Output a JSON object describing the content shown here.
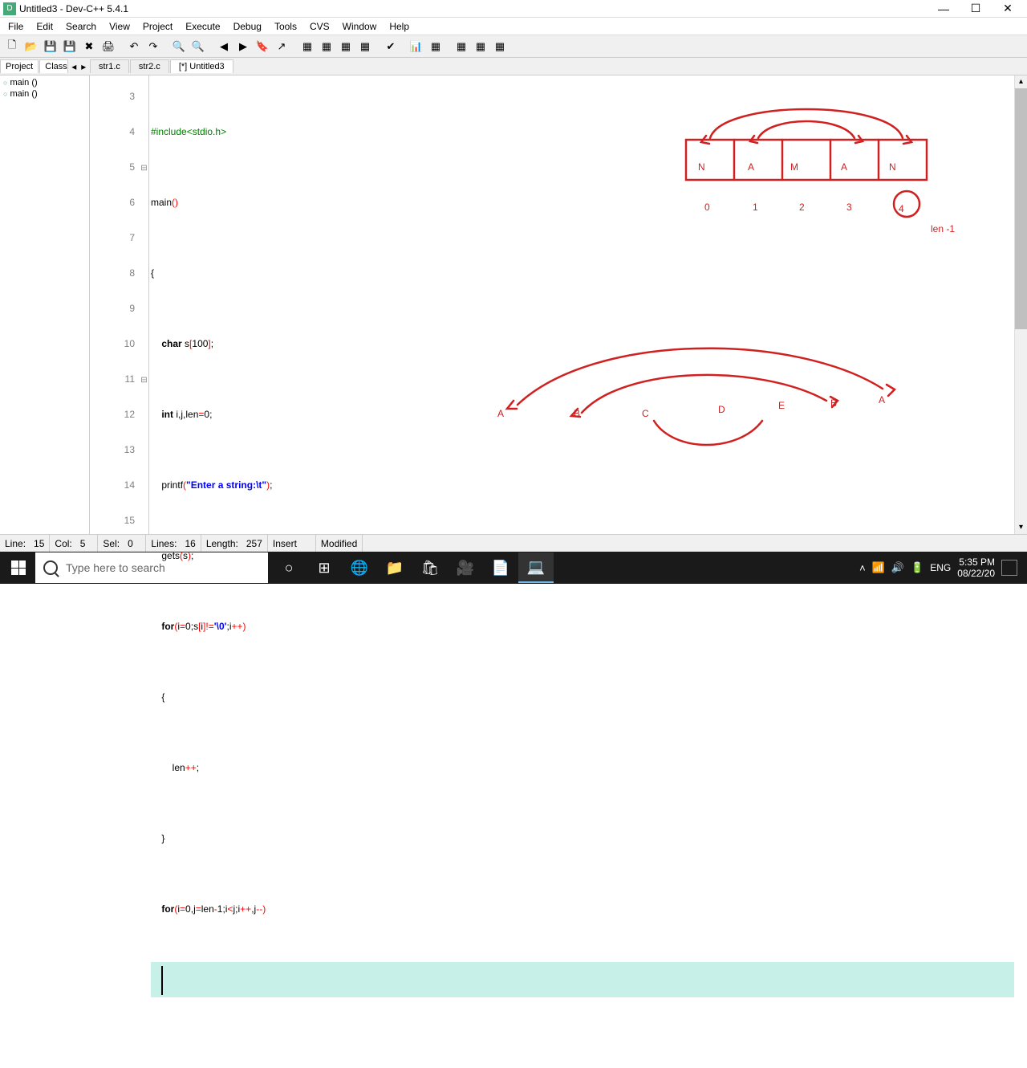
{
  "window": {
    "title": "Untitled3 - Dev-C++ 5.4.1"
  },
  "menu": {
    "items": [
      "File",
      "Edit",
      "Search",
      "View",
      "Project",
      "Execute",
      "Debug",
      "Tools",
      "CVS",
      "Window",
      "Help"
    ]
  },
  "sidebar_tabs": {
    "tab1": "Project",
    "tab2": "Classes"
  },
  "file_tabs": {
    "tab1": "str1.c",
    "tab2": "str2.c",
    "tab3": "[*] Untitled3"
  },
  "tree": {
    "item1": "main ()",
    "item2": "main ()"
  },
  "code": {
    "lines": {
      "l3": "#include<stdio.h>",
      "l4_main": "main",
      "l4_paren": "()",
      "l5": "{",
      "l6_kw": "char",
      "l6_rest": " s",
      "l6_br1": "[",
      "l6_num": "100",
      "l6_br2": "]",
      "l6_semi": ";",
      "l7_kw": "int",
      "l7_rest": " i,j,len",
      "l7_op": "=",
      "l7_num": "0",
      "l7_semi": ";",
      "l8_fn": "printf",
      "l8_p1": "(",
      "l8_str": "\"Enter a string:\\t\"",
      "l8_p2": ")",
      "l8_semi": ";",
      "l9_fn": "gets",
      "l9_p1": "(",
      "l9_arg": "s",
      "l9_p2": ")",
      "l9_semi": ";",
      "l10_kw": "for",
      "l10_p1": "(",
      "l10_a": "i",
      "l10_op1": "=",
      "l10_b": "0",
      "l10_semi1": ";",
      "l10_c": "s",
      "l10_br1": "[",
      "l10_d": "i",
      "l10_br2": "]",
      "l10_op2": "!=",
      "l10_str": "'\\0'",
      "l10_semi2": ";",
      "l10_e": "i",
      "l10_op3": "++)",
      "l11": "{",
      "l12_a": "len",
      "l12_op": "++",
      "l12_semi": ";",
      "l13": "}",
      "l14_kw": "for",
      "l14_p1": "(",
      "l14_a": "i",
      "l14_op1": "=",
      "l14_b": "0",
      "l14_c1": ",",
      "l14_c": "j",
      "l14_op2": "=",
      "l14_d": "len",
      "l14_op3": "-",
      "l14_e": "1",
      "l14_semi1": ";",
      "l14_f": "i",
      "l14_op4": "<",
      "l14_g": "j",
      "l14_semi2": ";",
      "l14_h": "i",
      "l14_op5": "++",
      "l14_c2": ",",
      "l14_i": "j",
      "l14_op6": "--)",
      "l15": ""
    },
    "line_numbers": [
      "3",
      "4",
      "5",
      "6",
      "7",
      "8",
      "9",
      "10",
      "11",
      "12",
      "13",
      "14",
      "15"
    ]
  },
  "status": {
    "line_label": "Line:",
    "line_val": "15",
    "col_label": "Col:",
    "col_val": "5",
    "sel_label": "Sel:",
    "sel_val": "0",
    "lines_label": "Lines:",
    "lines_val": "16",
    "length_label": "Length:",
    "length_val": "257",
    "insert": "Insert",
    "modified": "Modified"
  },
  "taskbar": {
    "search_placeholder": "Type here to search",
    "time": "5:35 PM",
    "date": "08/22/20",
    "lang": "ENG"
  },
  "annotations": {
    "type": "pen-drawing",
    "color": "#e03030",
    "drawings": [
      {
        "kind": "box-array",
        "cells": [
          "N",
          "A",
          "M",
          "A",
          "N"
        ],
        "indices": [
          "0",
          "1",
          "2",
          "3",
          "4"
        ],
        "note": "len -1",
        "arrows": "swap-outer-pairs"
      },
      {
        "kind": "letters-row",
        "letters": [
          "A",
          "B",
          "C",
          "D",
          "E",
          "B",
          "A"
        ],
        "arrows": "palindrome-swap-arcs"
      }
    ]
  }
}
